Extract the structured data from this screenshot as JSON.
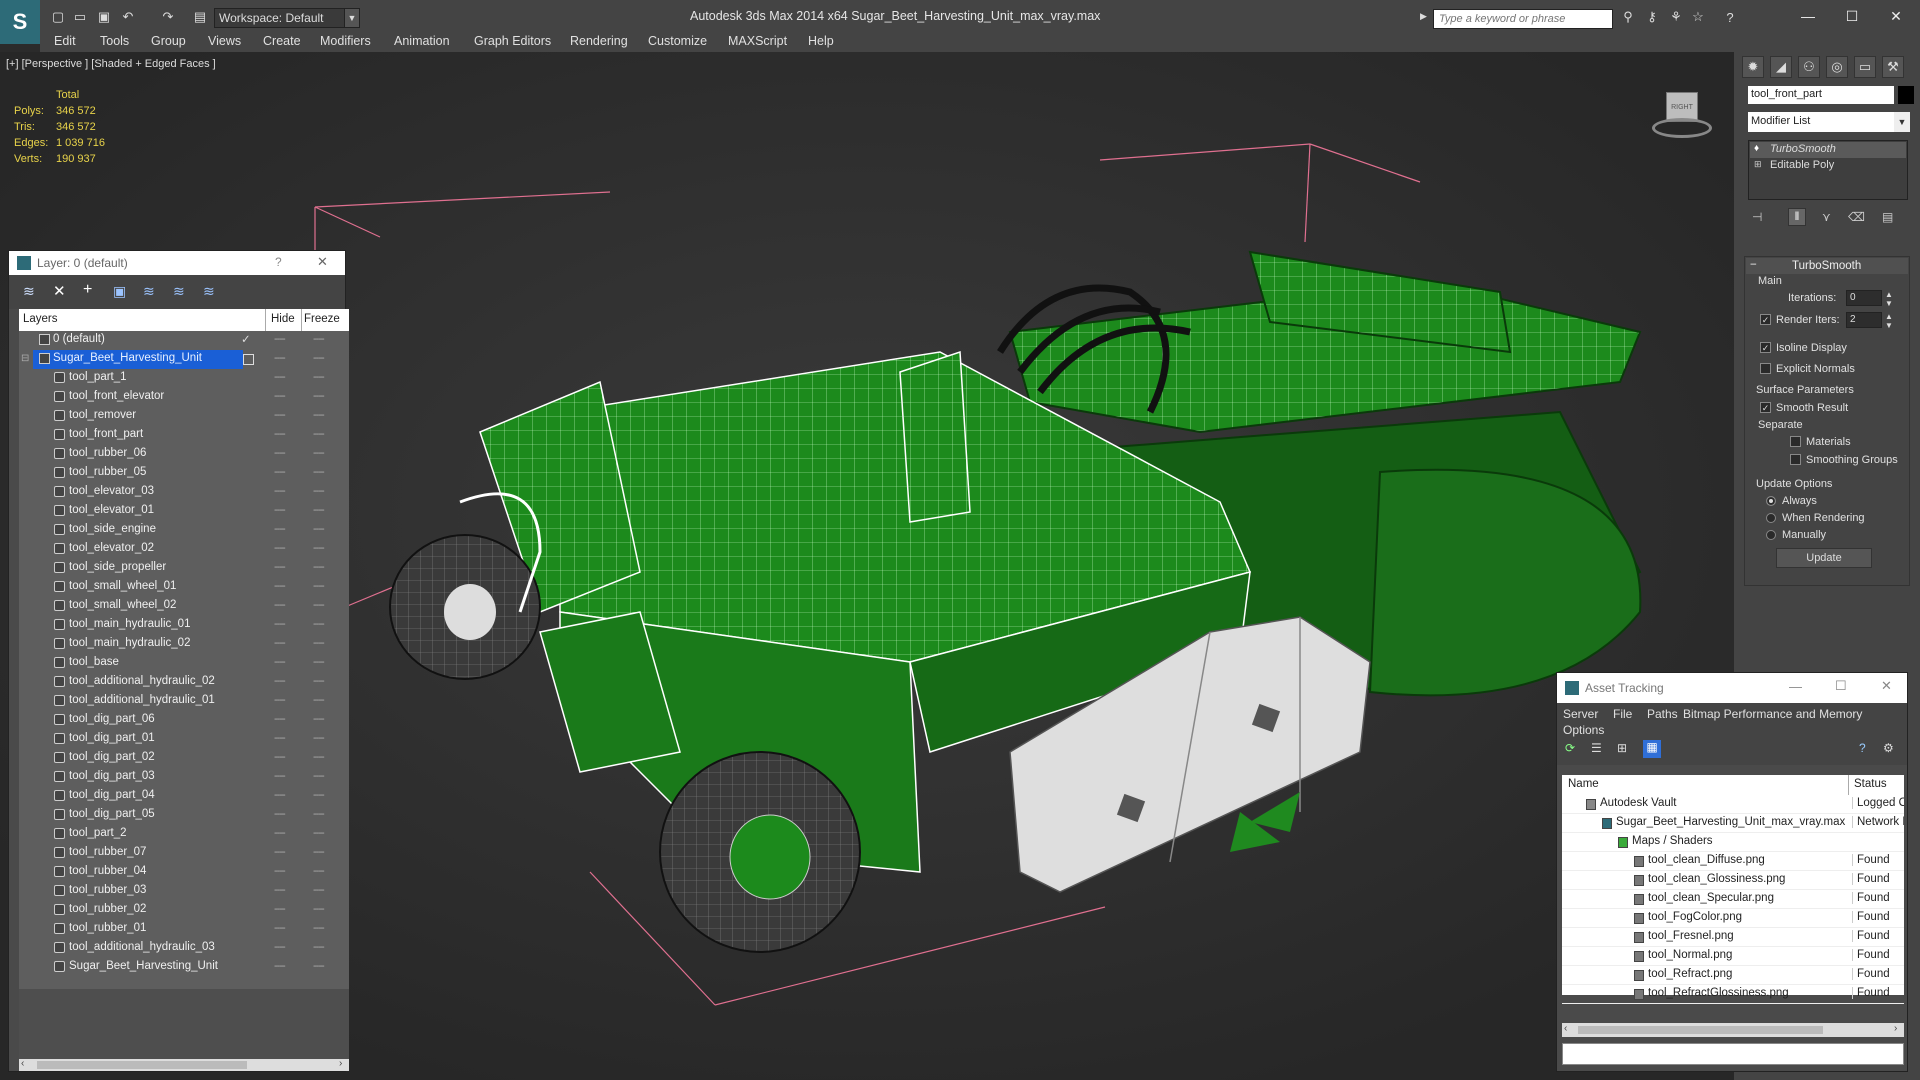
{
  "app": {
    "title": "Autodesk 3ds Max  2014 x64     Sugar_Beet_Harvesting_Unit_max_vray.max",
    "workspace": "Workspace: Default",
    "search_placeholder": "Type a keyword or phrase"
  },
  "menu": [
    "Edit",
    "Tools",
    "Group",
    "Views",
    "Create",
    "Modifiers",
    "Animation",
    "Graph Editors",
    "Rendering",
    "Customize",
    "MAXScript",
    "Help"
  ],
  "viewport": {
    "label": "[+] [Perspective ] [Shaded + Edged Faces ]",
    "stats_total_label": "Total",
    "stats": [
      {
        "label": "Polys:",
        "value": "346 572"
      },
      {
        "label": "Tris:",
        "value": "346 572"
      },
      {
        "label": "Edges:",
        "value": "1 039 716"
      },
      {
        "label": "Verts:",
        "value": "190 937"
      }
    ],
    "cube_label": "RIGHT"
  },
  "layer_dialog": {
    "title": "Layer: 0 (default)",
    "help": "?",
    "close": "✕",
    "columns": {
      "layers": "Layers",
      "hide": "Hide",
      "freeze": "Freeze"
    },
    "root_layers": [
      {
        "name": "0 (default)"
      },
      {
        "name": "Sugar_Beet_Harvesting_Unit"
      }
    ],
    "objects": [
      "tool_part_1",
      "tool_front_elevator",
      "tool_remover",
      "tool_front_part",
      "tool_rubber_06",
      "tool_rubber_05",
      "tool_elevator_03",
      "tool_elevator_01",
      "tool_side_engine",
      "tool_elevator_02",
      "tool_side_propeller",
      "tool_small_wheel_01",
      "tool_small_wheel_02",
      "tool_main_hydraulic_01",
      "tool_main_hydraulic_02",
      "tool_base",
      "tool_additional_hydraulic_02",
      "tool_additional_hydraulic_01",
      "tool_dig_part_06",
      "tool_dig_part_01",
      "tool_dig_part_02",
      "tool_dig_part_03",
      "tool_dig_part_04",
      "tool_dig_part_05",
      "tool_part_2",
      "tool_rubber_07",
      "tool_rubber_04",
      "tool_rubber_03",
      "tool_rubber_02",
      "tool_rubber_01",
      "tool_additional_hydraulic_03",
      "Sugar_Beet_Harvesting_Unit"
    ],
    "dashes": "----"
  },
  "command_panel": {
    "object_name": "tool_front_part",
    "modifier_list": "Modifier List",
    "stack": [
      "TurboSmooth",
      "Editable Poly"
    ],
    "turbosmooth": {
      "title": "TurboSmooth",
      "main": "Main",
      "iterations_label": "Iterations:",
      "iterations": "0",
      "render_iters_label": "Render Iters:",
      "render_iters": "2",
      "isoline": "Isoline Display",
      "explicit_normals": "Explicit Normals",
      "surface_params": "Surface Parameters",
      "smooth_result": "Smooth Result",
      "separate": "Separate",
      "materials": "Materials",
      "smoothing_groups": "Smoothing Groups",
      "update_options": "Update Options",
      "always": "Always",
      "when_rendering": "When Rendering",
      "manually": "Manually",
      "update": "Update"
    }
  },
  "asset_tracking": {
    "title": "Asset Tracking",
    "menu": [
      "Server",
      "File",
      "Paths",
      "Bitmap Performance and Memory",
      "Options"
    ],
    "columns": {
      "name": "Name",
      "status": "Status"
    },
    "rows": [
      {
        "name": "Autodesk Vault",
        "status": "Logged O",
        "indent": 1
      },
      {
        "name": "Sugar_Beet_Harvesting_Unit_max_vray.max",
        "status": "Network F",
        "indent": 2
      },
      {
        "name": "Maps / Shaders",
        "status": "",
        "indent": 3
      },
      {
        "name": "tool_clean_Diffuse.png",
        "status": "Found",
        "indent": 4
      },
      {
        "name": "tool_clean_Glossiness.png",
        "status": "Found",
        "indent": 4
      },
      {
        "name": "tool_clean_Specular.png",
        "status": "Found",
        "indent": 4
      },
      {
        "name": "tool_FogColor.png",
        "status": "Found",
        "indent": 4
      },
      {
        "name": "tool_Fresnel.png",
        "status": "Found",
        "indent": 4
      },
      {
        "name": "tool_Normal.png",
        "status": "Found",
        "indent": 4
      },
      {
        "name": "tool_Refract.png",
        "status": "Found",
        "indent": 4
      },
      {
        "name": "tool_RefractGlossiness.png",
        "status": "Found",
        "indent": 4
      }
    ]
  },
  "colors": {
    "accent": "#2d6b78",
    "model_green": "#1f8a1f",
    "stats_yellow": "#e8d34a",
    "selection_blue": "#1a5fd6"
  }
}
